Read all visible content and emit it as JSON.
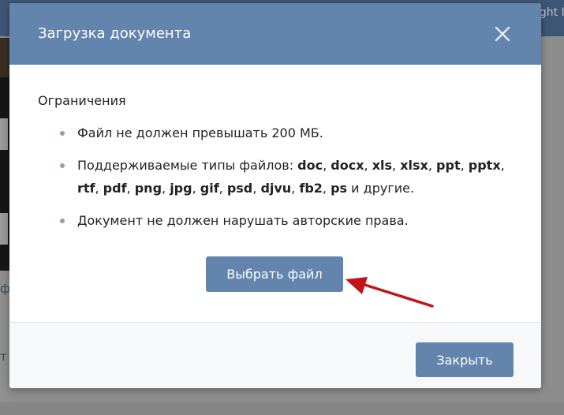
{
  "background": {
    "topbar_text": "ight I",
    "left_text_1": "ф",
    "left_text_2": "т"
  },
  "modal": {
    "title": "Загрузка документа",
    "close_icon": "close-icon",
    "section_heading": "Ограничения",
    "rules": [
      {
        "lines": [
          [
            {
              "text": "Файл не должен превышать 200 МБ.",
              "bold": false
            }
          ]
        ]
      },
      {
        "lines": [
          [
            {
              "text": "Поддерживаемые типы файлов: ",
              "bold": false
            },
            {
              "text": "doc",
              "bold": true
            },
            {
              "text": ", ",
              "bold": false
            },
            {
              "text": "docx",
              "bold": true
            },
            {
              "text": ", ",
              "bold": false
            },
            {
              "text": "xls",
              "bold": true
            },
            {
              "text": ", ",
              "bold": false
            },
            {
              "text": "xlsx",
              "bold": true
            },
            {
              "text": ", ",
              "bold": false
            },
            {
              "text": "ppt",
              "bold": true
            },
            {
              "text": ", ",
              "bold": false
            },
            {
              "text": "pptx",
              "bold": true
            },
            {
              "text": ",",
              "bold": false
            }
          ],
          [
            {
              "text": "rtf",
              "bold": true
            },
            {
              "text": ", ",
              "bold": false
            },
            {
              "text": "pdf",
              "bold": true
            },
            {
              "text": ", ",
              "bold": false
            },
            {
              "text": "png",
              "bold": true
            },
            {
              "text": ", ",
              "bold": false
            },
            {
              "text": "jpg",
              "bold": true
            },
            {
              "text": ", ",
              "bold": false
            },
            {
              "text": "gif",
              "bold": true
            },
            {
              "text": ", ",
              "bold": false
            },
            {
              "text": "psd",
              "bold": true
            },
            {
              "text": ", ",
              "bold": false
            },
            {
              "text": "djvu",
              "bold": true
            },
            {
              "text": ", ",
              "bold": false
            },
            {
              "text": "fb2",
              "bold": true
            },
            {
              "text": ", ",
              "bold": false
            },
            {
              "text": "ps",
              "bold": true
            },
            {
              "text": " и другие.",
              "bold": false
            }
          ]
        ]
      },
      {
        "lines": [
          [
            {
              "text": "Документ не должен нарушать авторские права.",
              "bold": false
            }
          ]
        ]
      }
    ],
    "choose_file_label": "Выбрать файл",
    "close_button_label": "Закрыть"
  },
  "colors": {
    "header": "#6384ad",
    "button": "#6384ad",
    "bullet": "#8ba2bf",
    "arrow": "#c0141b"
  }
}
